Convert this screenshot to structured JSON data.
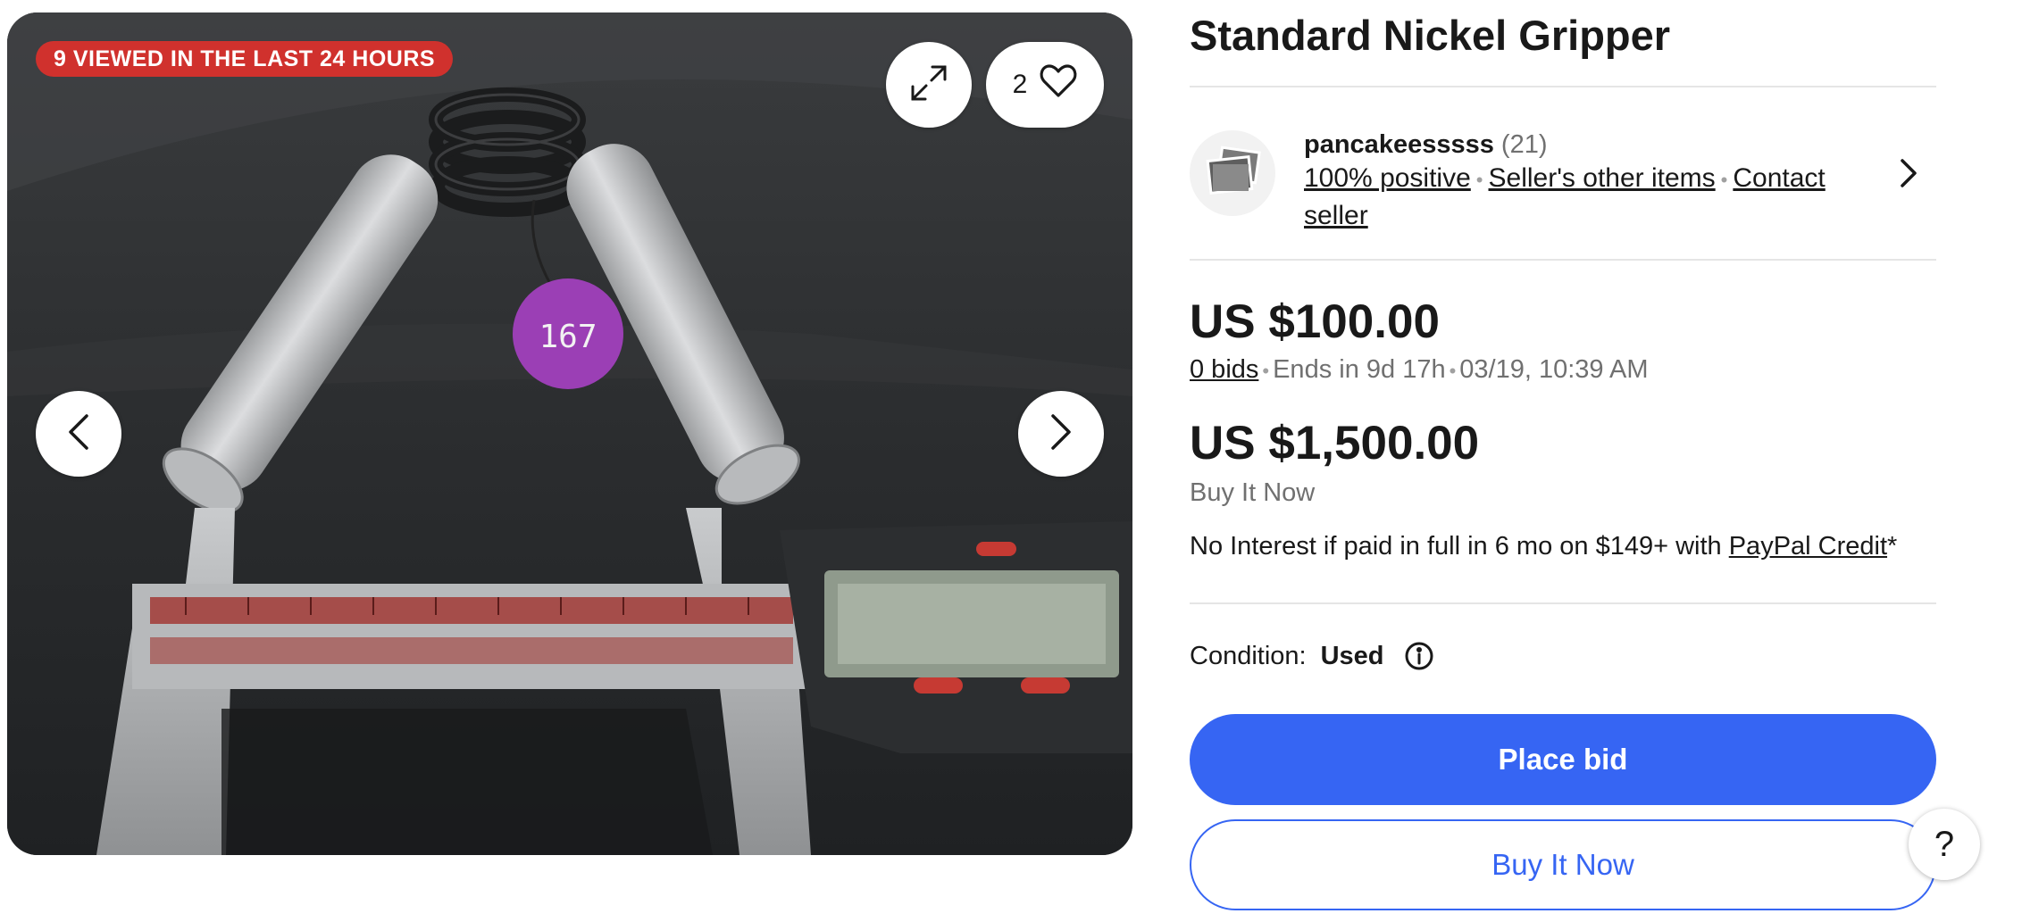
{
  "gallery": {
    "viewed_badge": "9 VIEWED IN THE LAST 24 HOURS",
    "watch_count": "2",
    "tag_number": "167",
    "badge_color": "#d0312d"
  },
  "item": {
    "title": "Standard Nickel Gripper"
  },
  "seller": {
    "name": "pancakeesssss",
    "feedback_count": "(21)",
    "positive": "100% positive",
    "other_items": "Seller's other items",
    "contact": "Contact seller"
  },
  "auction": {
    "current_price": "US $100.00",
    "bids": "0 bids",
    "ends_in": "Ends in 9d 17h",
    "end_date": "03/19, 10:39 AM"
  },
  "buy_now": {
    "price": "US $1,500.00",
    "label": "Buy It Now"
  },
  "financing": {
    "text": "No Interest if paid in full in 6 mo on $149+ with ",
    "link": "PayPal Credit",
    "suffix": "*"
  },
  "condition": {
    "label": "Condition:",
    "value": "Used"
  },
  "actions": {
    "place_bid": "Place bid",
    "buy_it_now": "Buy It Now",
    "help": "?",
    "accent_color": "#3665f3"
  },
  "icons": {
    "expand": "expand-icon",
    "watch": "heart-icon",
    "prev": "chevron-left-icon",
    "next": "chevron-right-icon",
    "seller_avatar": "photo-stack-icon",
    "seller_nav": "chevron-right-icon",
    "info": "info-icon"
  }
}
